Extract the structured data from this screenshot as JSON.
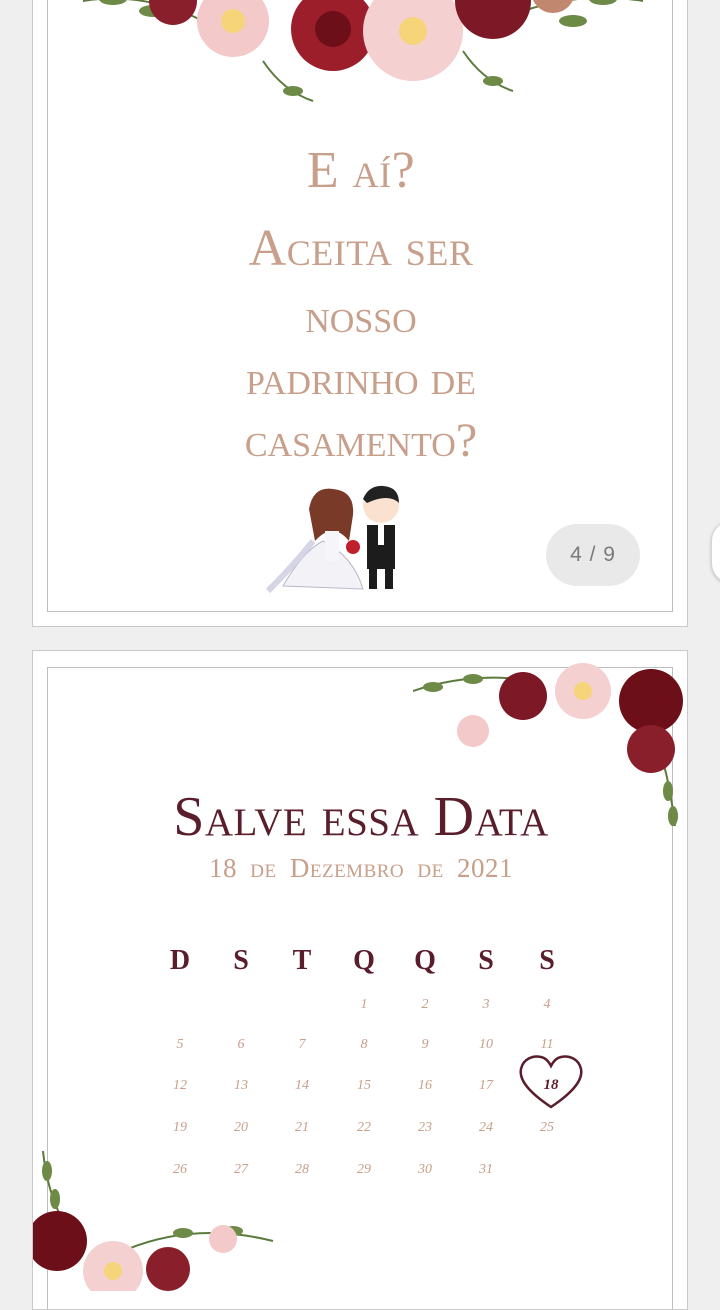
{
  "slide1": {
    "question_lines": [
      "E aí?",
      "Aceita ser",
      "nosso",
      "padrinho de",
      "casamento?"
    ],
    "counter": "4 / 9"
  },
  "slide2": {
    "title": "Salve essa Data",
    "date": "18 de Dezembro de 2021",
    "weekdays": [
      "D",
      "S",
      "T",
      "Q",
      "Q",
      "S",
      "S"
    ],
    "weeks": [
      [
        "",
        "",
        "",
        "1",
        "2",
        "3",
        "4"
      ],
      [
        "5",
        "6",
        "7",
        "8",
        "9",
        "10",
        "11"
      ],
      [
        "12",
        "13",
        "14",
        "15",
        "16",
        "17",
        "18"
      ],
      [
        "19",
        "20",
        "21",
        "22",
        "23",
        "24",
        "25"
      ],
      [
        "26",
        "27",
        "28",
        "29",
        "30",
        "31",
        ""
      ]
    ],
    "highlight_day": "18"
  },
  "colors": {
    "text_rose": "#c79f8a",
    "text_burgundy": "#5a1d2c",
    "background": "#efefef"
  },
  "icons": [
    "floral-decoration",
    "couple-illustration",
    "heart-icon"
  ]
}
